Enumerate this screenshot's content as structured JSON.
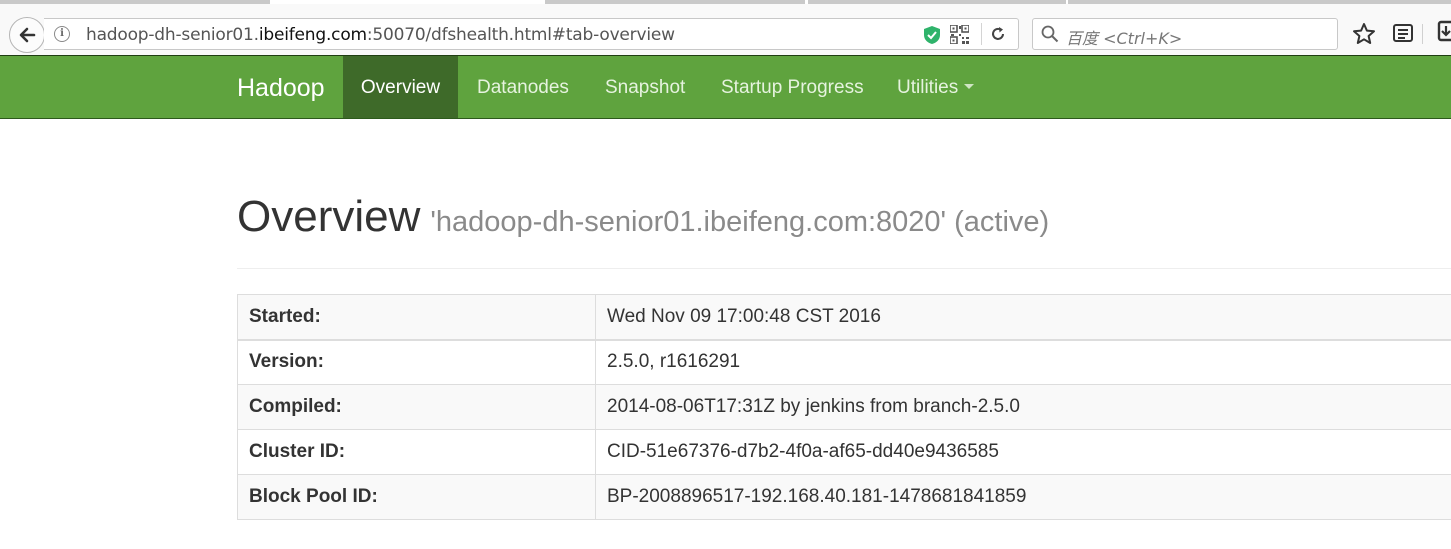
{
  "browser": {
    "url": {
      "prefix": "hadoop-dh-senior01.",
      "host": "ibeifeng.com",
      "suffix": ":50070/dfshealth.html#tab-overview"
    },
    "search_placeholder": "百度 <Ctrl+K>",
    "colors": {
      "shield": "#2fb36b",
      "chrome": "#f9f9f9"
    }
  },
  "navbar": {
    "brand": "Hadoop",
    "items": [
      {
        "label": "Overview",
        "active": true
      },
      {
        "label": "Datanodes"
      },
      {
        "label": "Snapshot"
      },
      {
        "label": "Startup Progress"
      },
      {
        "label": "Utilities",
        "dropdown": true
      }
    ],
    "colors": {
      "background": "#5fa33e",
      "active": "#3e6a29"
    }
  },
  "overview": {
    "title": "Overview",
    "subtitle": "'hadoop-dh-senior01.ibeifeng.com:8020' (active)",
    "rows": [
      {
        "label": "Started:",
        "value": "Wed Nov 09 17:00:48 CST 2016"
      },
      {
        "label": "Version:",
        "value": "2.5.0, r1616291"
      },
      {
        "label": "Compiled:",
        "value": "2014-08-06T17:31Z by jenkins from branch-2.5.0"
      },
      {
        "label": "Cluster ID:",
        "value": "CID-51e67376-d7b2-4f0a-af65-dd40e9436585"
      },
      {
        "label": "Block Pool ID:",
        "value": "BP-2008896517-192.168.40.181-1478681841859"
      }
    ]
  }
}
